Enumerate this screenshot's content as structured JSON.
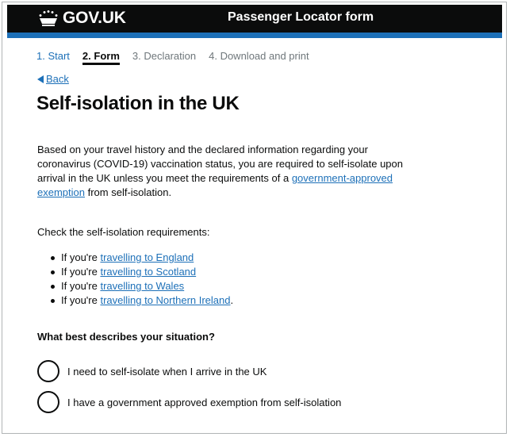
{
  "header": {
    "logo_text": "GOV.UK",
    "service_name": "Passenger Locator form",
    "colors": {
      "background": "#0b0c0c",
      "accent_bar": "#1d70b8"
    }
  },
  "steps": [
    {
      "label": "1. Start",
      "state": "done"
    },
    {
      "label": "2. Form",
      "state": "current"
    },
    {
      "label": "3. Declaration",
      "state": "todo"
    },
    {
      "label": "4. Download and print",
      "state": "todo"
    }
  ],
  "back_link": "Back",
  "page_title": "Self-isolation in the UK",
  "intro": {
    "text_before": "Based on your travel history and the declared information regarding your coronavirus (COVID-19) vaccination status, you are required to self-isolate upon arrival in the UK unless you meet the requirements of a ",
    "link": "government-approved exemption",
    "text_after": " from self-isolation."
  },
  "check_intro": "Check the self-isolation requirements:",
  "bullets": [
    {
      "prefix": "If you're ",
      "link": "travelling to England",
      "suffix": ""
    },
    {
      "prefix": "If you're ",
      "link": "travelling to Scotland",
      "suffix": ""
    },
    {
      "prefix": "If you're ",
      "link": "travelling to Wales",
      "suffix": ""
    },
    {
      "prefix": "If you're ",
      "link": "travelling to Northern Ireland",
      "suffix": "."
    }
  ],
  "question": "What best describes your situation?",
  "options": [
    {
      "label": "I need to self-isolate when I arrive in the UK"
    },
    {
      "label": "I have a government approved exemption from self-isolation"
    }
  ],
  "icons": {
    "crown": "crown-icon",
    "back": "back-triangle-icon"
  }
}
